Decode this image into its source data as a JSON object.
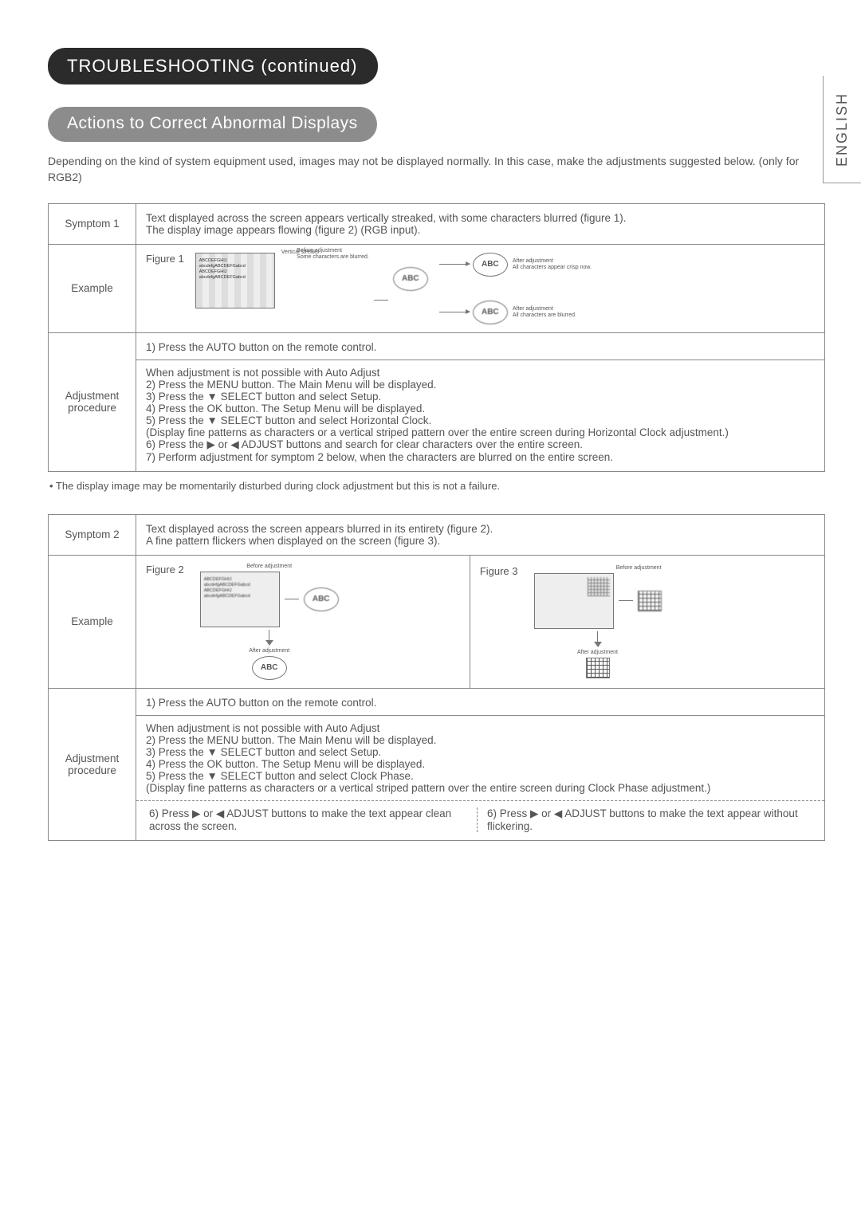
{
  "sideTab": "ENGLISH",
  "heading1": "TROUBLESHOOTING (continued)",
  "heading2": "Actions to Correct Abnormal Displays",
  "intro": "Depending on the kind of system equipment used, images may not be displayed normally.  In this case, make the adjustments suggested below. (only for RGB2)",
  "labels": {
    "symptom1": "Symptom 1",
    "symptom2": "Symptom 2",
    "example": "Example",
    "adjProc": "Adjustment procedure"
  },
  "s1": {
    "symptom": "Text displayed across the screen appears vertically streaked, with some characters blurred (figure 1).\nThe display image appears flowing (figure 2) (RGB input).",
    "fig1": "Figure 1",
    "screenLines": "ABCDEFGHIJ\nabcdefgABCDEFGabcd\nABCDEFGHIJ\nabcdefgABCDEFGabcd",
    "capVertStreaks": "Vertical streaks",
    "capBefore": "Before adjustment\nSome characters are blurred.",
    "capAfterCrisp": "After adjustment\nAll characters appear crisp now.",
    "capAfterBlur": "After adjustment\nAll characters are blurred.",
    "abc": "ABC",
    "step1": "1) Press the AUTO button on the remote control.",
    "stepsRest": "When adjustment is not possible with Auto Adjust\n2) Press the MENU button. The Main Menu will be displayed.\n3) Press the ▼ SELECT button and select Setup.\n4) Press the OK button. The Setup Menu will be displayed.\n5) Press the ▼ SELECT button and select Horizontal Clock.\n(Display fine patterns as characters or a vertical striped pattern over the entire screen during Horizontal Clock adjustment.)\n6) Press the ▶ or ◀ ADJUST buttons and search for clear characters over the entire screen.\n7) Perform adjustment for symptom 2 below, when the characters are blurred on the entire screen."
  },
  "midNote": "• The display image may be momentarily disturbed during clock adjustment but this is not a failure.",
  "s2": {
    "symptom": "Text displayed across the screen appears blurred in its entirety (figure 2).\nA fine pattern flickers when displayed on the screen (figure 3).",
    "fig2": "Figure 2",
    "fig3": "Figure 3",
    "before": "Before adjustment",
    "after": "After adjustment",
    "screenLines": "ABCDEFGHIJ\nabcdefgABCDEFGabcd\nABCDEFGHIJ\nabcdefgABCDEFGabcd",
    "abcBold": "ABC",
    "step1": "1) Press the AUTO button on the remote control.",
    "stepsRest": "When adjustment is not possible with Auto Adjust\n2) Press the MENU button. The Main Menu will be displayed.\n3) Press the ▼ SELECT button and select Setup.\n4) Press the OK button. The Setup Menu will be displayed.\n5) Press the ▼ SELECT button and select Clock Phase.\n(Display fine patterns as characters or a vertical striped pattern over the entire screen during Clock Phase adjustment.)",
    "step6a": "6) Press ▶ or ◀ ADJUST buttons to make the text appear clean across the screen.",
    "step6b": "6) Press ▶ or ◀ ADJUST buttons to make the text appear without flickering."
  }
}
